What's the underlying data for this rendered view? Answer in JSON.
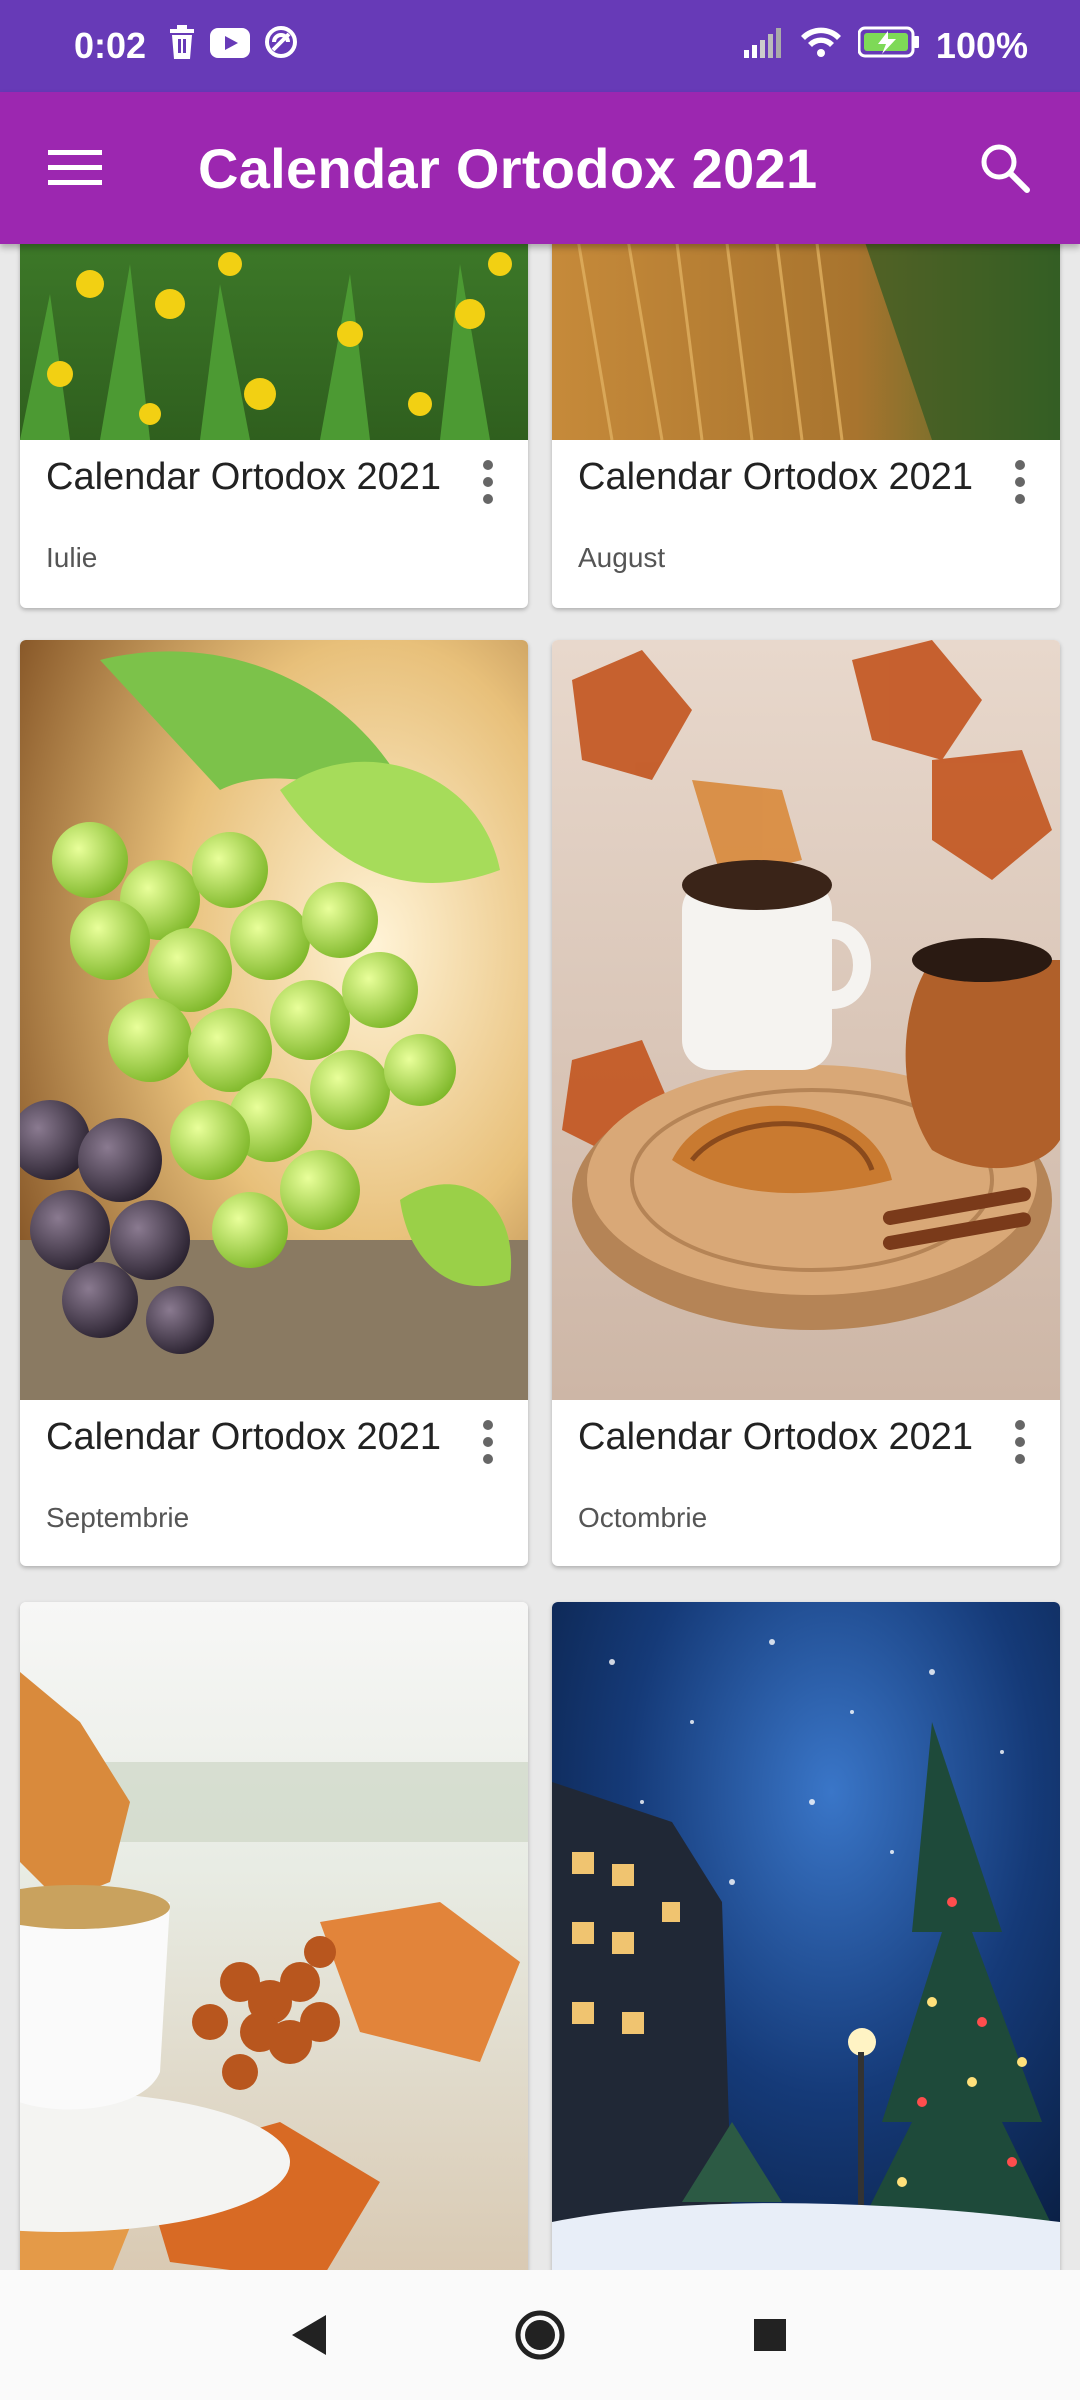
{
  "status_bar": {
    "time": "0:02",
    "battery": "100%",
    "icons": [
      "trash-icon",
      "youtube-icon",
      "sync-icon",
      "signal-icon",
      "wifi-icon",
      "battery-charging-icon"
    ]
  },
  "app_bar": {
    "title": "Calendar Ortodox 2021",
    "menu_icon": "hamburger-menu-icon",
    "search_icon": "search-icon"
  },
  "cards": [
    {
      "title": "Calendar Ortodox 2021",
      "subtitle": "Iulie",
      "image": "dandelion-field"
    },
    {
      "title": "Calendar Ortodox 2021",
      "subtitle": "August",
      "image": "wheat-field"
    },
    {
      "title": "Calendar Ortodox 2021",
      "subtitle": "Septembrie",
      "image": "grapes"
    },
    {
      "title": "Calendar Ortodox 2021",
      "subtitle": "Octombrie",
      "image": "coffee-croissant"
    },
    {
      "title": "",
      "subtitle": "",
      "image": "autumn-tea-cup"
    },
    {
      "title": "",
      "subtitle": "",
      "image": "winter-night-street"
    }
  ],
  "nav_bar": {
    "back_icon": "back-triangle-icon",
    "home_icon": "home-circle-icon",
    "recents_icon": "recents-square-icon"
  },
  "colors": {
    "status_bar": "#673ab7",
    "app_bar": "#9c27b0",
    "background": "#e9e9e9"
  }
}
